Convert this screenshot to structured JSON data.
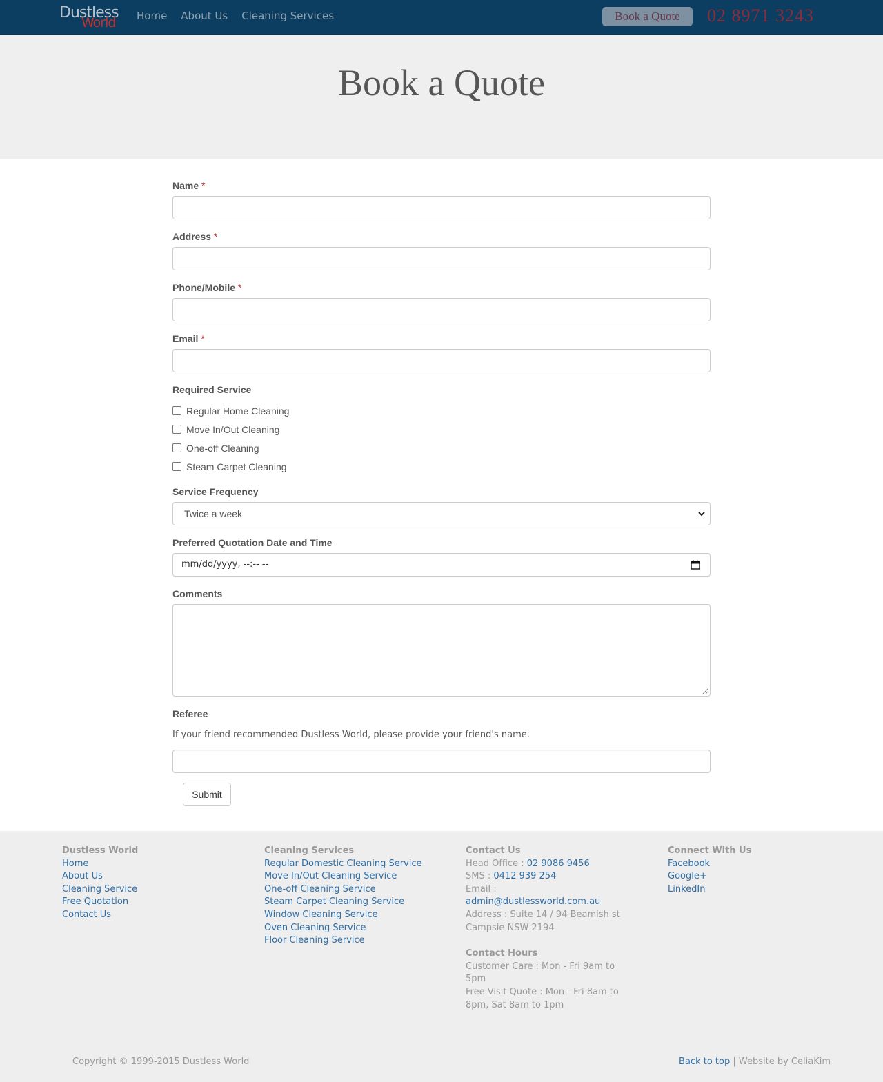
{
  "navbar": {
    "logo_top": "Dustless",
    "logo_bottom": "World",
    "links": [
      "Home",
      "About Us",
      "Cleaning Services"
    ],
    "quote_button": "Book a Quote",
    "phone": "02 8971 3243"
  },
  "hero": {
    "title": "Book a Quote"
  },
  "form": {
    "required_mark": "*",
    "name_label": "Name",
    "address_label": "Address",
    "phone_label": "Phone/Mobile",
    "email_label": "Email",
    "service_label": "Required Service",
    "services": [
      "Regular Home Cleaning",
      "Move In/Out Cleaning",
      "One-off Cleaning",
      "Steam Carpet Cleaning"
    ],
    "frequency_label": "Service Frequency",
    "frequency_value": "Twice a week",
    "datetime_label": "Preferred Quotation Date and Time",
    "datetime_placeholder": "mm/dd/yyyy, --:-- --",
    "comments_label": "Comments",
    "referee_label": "Referee",
    "referee_help": "If your friend recommended Dustless World, please provide your friend's name.",
    "submit_label": "Submit"
  },
  "footer": {
    "col1": {
      "heading": "Dustless World",
      "links": [
        "Home",
        "About Us",
        "Cleaning Service",
        "Free Quotation",
        "Contact Us"
      ]
    },
    "col2": {
      "heading": "Cleaning Services",
      "links": [
        "Regular Domestic Cleaning Service",
        "Move In/Out Cleaning Service",
        "One-off Cleaning Service",
        "Steam Carpet Cleaning Service",
        "Window Cleaning Service",
        "Oven Cleaning Service",
        "Floor Cleaning Service"
      ]
    },
    "col3": {
      "heading": "Contact Us",
      "head_office_label": "Head Office :",
      "head_office_phone": "02 9086 9456",
      "sms_label": "SMS :",
      "sms_number": "0412 939 254",
      "email_label": "Email :",
      "email": "admin@dustlessworld.com.au",
      "address_line1": "Address : Suite 14 / 94 Beamish st",
      "address_line2": "Campsie NSW 2194",
      "hours_heading": "Contact Hours",
      "hours_line1": "Customer Care : Mon - Fri 9am to",
      "hours_line2": "5pm",
      "hours_line3": "Free Visit Quote : Mon - Fri 8am to",
      "hours_line4": "8pm, Sat 8am to 1pm"
    },
    "col4": {
      "heading": "Connect With Us",
      "links": [
        "Facebook",
        "Google+",
        "LinkedIn"
      ]
    },
    "copyright": "Copyright © 1999-2015 Dustless World",
    "back_to_top": "Back to top",
    "separator": "|",
    "website_by": "Website by CeliaKim"
  }
}
